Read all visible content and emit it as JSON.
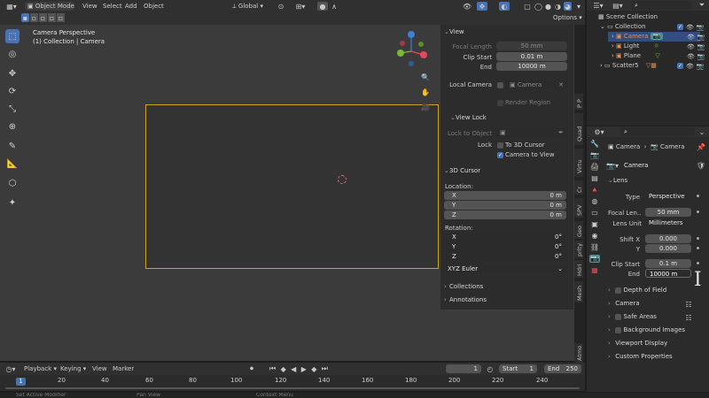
{
  "top_header": {
    "mode": "Object Mode",
    "menus": [
      "View",
      "Select",
      "Add",
      "Object"
    ],
    "transform": "Global",
    "options": "Options"
  },
  "viewport": {
    "title": "Camera Perspective",
    "subtitle": "(1) Collection | Camera"
  },
  "sidebar": {
    "tabs": [
      "Atmo",
      "Mesh",
      "Hdri",
      "prlty",
      "Geo",
      "SPV",
      "Cr",
      "Virtu",
      "Quad",
      "P P"
    ],
    "view_panel": {
      "title": "View",
      "focal_length_label": "Focal Length",
      "focal_length": "50 mm",
      "clip_start_label": "Clip Start",
      "clip_start": "0.01 m",
      "end_label": "End",
      "end": "10000 m",
      "local_camera_label": "Local Camera",
      "local_camera": "Camera",
      "render_region": "Render Region"
    },
    "view_lock": {
      "title": "View Lock",
      "lock_to_object_label": "Lock to Object",
      "lock_label": "Lock",
      "to_3d_cursor": "To 3D Cursor",
      "camera_to_view": "Camera to View"
    },
    "cursor_panel": {
      "title": "3D Cursor",
      "location_label": "Location:",
      "loc": [
        {
          "axis": "X",
          "value": "0 m"
        },
        {
          "axis": "Y",
          "value": "0 m"
        },
        {
          "axis": "Z",
          "value": "0 m"
        }
      ],
      "rotation_label": "Rotation:",
      "rot": [
        {
          "axis": "X",
          "value": "0°"
        },
        {
          "axis": "Y",
          "value": "0°"
        },
        {
          "axis": "Z",
          "value": "0°"
        }
      ],
      "rotation_mode": "XYZ Euler"
    },
    "collections": "Collections",
    "annotations": "Annotations"
  },
  "outliner": {
    "items": [
      {
        "label": "Scene Collection",
        "indent": 0
      },
      {
        "label": "Collection",
        "indent": 1
      },
      {
        "label": "Camera",
        "indent": 2
      },
      {
        "label": "Light",
        "indent": 2
      },
      {
        "label": "Plane",
        "indent": 2
      },
      {
        "label": "Scatter5",
        "indent": 1
      }
    ]
  },
  "properties": {
    "breadcrumb_a": "Camera",
    "breadcrumb_b": "Camera",
    "datablock": "Camera",
    "lens_title": "Lens",
    "type_label": "Type",
    "type_value": "Perspective",
    "focal_label": "Focal Len...",
    "focal_value": "50 mm",
    "lens_unit_label": "Lens Unit",
    "lens_unit_value": "Millimeters",
    "shift_x_label": "Shift X",
    "shift_x_value": "0.000",
    "shift_y_label": "Y",
    "shift_y_value": "0.000",
    "clip_start_label": "Clip Start",
    "clip_start_value": "0.1 m",
    "end_label": "End",
    "end_value": "10000 m",
    "subpanels": [
      "Depth of Field",
      "Camera",
      "Safe Areas",
      "Background Images",
      "Viewport Display",
      "Custom Properties"
    ]
  },
  "timeline": {
    "menus": [
      "Playback",
      "Keying",
      "View",
      "Marker"
    ],
    "current_frame": "1",
    "start_label": "Start",
    "start": "1",
    "end_label": "End",
    "end": "250",
    "ticks": [
      "20",
      "40",
      "60",
      "80",
      "100",
      "120",
      "140",
      "160",
      "180",
      "200",
      "220",
      "240"
    ],
    "frame_badge": "1"
  },
  "status_bar": {
    "items": [
      "Set Active Modifier",
      "Pan View",
      "Context Menu"
    ]
  },
  "colors": {
    "accent": "#4772b3",
    "camera_frame": "#c9a227",
    "axis_x": "#e04a5c",
    "axis_y": "#7ab836",
    "axis_z": "#3d7fd6"
  }
}
